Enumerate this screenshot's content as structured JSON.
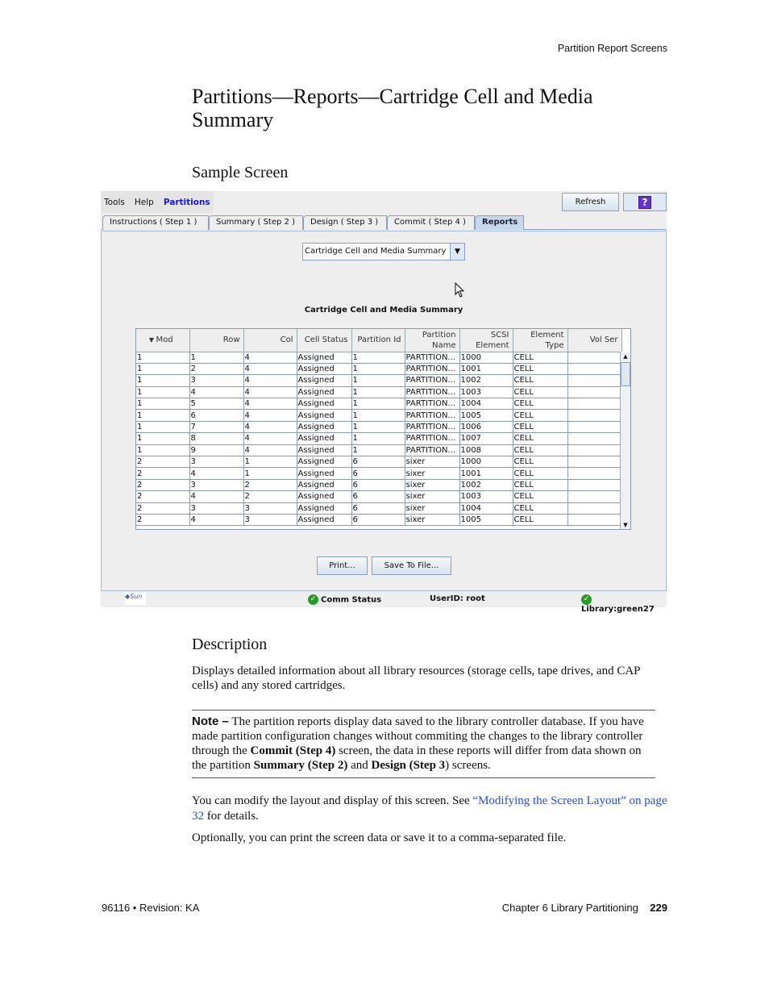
{
  "running_head": "Partition Report Screens",
  "title": "Partitions—Reports—Cartridge Cell and Media Summary",
  "sample_heading": "Sample Screen",
  "app": {
    "menu": [
      "Tools",
      "Help",
      "Partitions"
    ],
    "refresh_label": "Refresh",
    "help_label": "?",
    "tabs": [
      "Instructions ( Step 1 )",
      "Summary ( Step 2 )",
      "Design ( Step 3 )",
      "Commit ( Step 4 )",
      "Reports"
    ],
    "active_tab": "Reports",
    "report_select": "Cartridge Cell and Media Summary",
    "table_title": "Cartridge Cell and Media Summary",
    "columns": [
      "Mod",
      "Row",
      "Col",
      "Cell Status",
      "Partition Id",
      "Partition Name",
      "SCSI Element",
      "Element Type",
      "Vol Ser"
    ],
    "sort_column": "Mod",
    "rows": [
      [
        "1",
        "1",
        "4",
        "Assigned",
        "1",
        "PARTITION...",
        "1000",
        "CELL",
        ""
      ],
      [
        "1",
        "2",
        "4",
        "Assigned",
        "1",
        "PARTITION...",
        "1001",
        "CELL",
        ""
      ],
      [
        "1",
        "3",
        "4",
        "Assigned",
        "1",
        "PARTITION...",
        "1002",
        "CELL",
        ""
      ],
      [
        "1",
        "4",
        "4",
        "Assigned",
        "1",
        "PARTITION...",
        "1003",
        "CELL",
        ""
      ],
      [
        "1",
        "5",
        "4",
        "Assigned",
        "1",
        "PARTITION...",
        "1004",
        "CELL",
        ""
      ],
      [
        "1",
        "6",
        "4",
        "Assigned",
        "1",
        "PARTITION...",
        "1005",
        "CELL",
        ""
      ],
      [
        "1",
        "7",
        "4",
        "Assigned",
        "1",
        "PARTITION...",
        "1006",
        "CELL",
        ""
      ],
      [
        "1",
        "8",
        "4",
        "Assigned",
        "1",
        "PARTITION...",
        "1007",
        "CELL",
        ""
      ],
      [
        "1",
        "9",
        "4",
        "Assigned",
        "1",
        "PARTITION...",
        "1008",
        "CELL",
        ""
      ],
      [
        "2",
        "3",
        "1",
        "Assigned",
        "6",
        "sixer",
        "1000",
        "CELL",
        ""
      ],
      [
        "2",
        "4",
        "1",
        "Assigned",
        "6",
        "sixer",
        "1001",
        "CELL",
        ""
      ],
      [
        "2",
        "3",
        "2",
        "Assigned",
        "6",
        "sixer",
        "1002",
        "CELL",
        ""
      ],
      [
        "2",
        "4",
        "2",
        "Assigned",
        "6",
        "sixer",
        "1003",
        "CELL",
        ""
      ],
      [
        "2",
        "3",
        "3",
        "Assigned",
        "6",
        "sixer",
        "1004",
        "CELL",
        ""
      ],
      [
        "2",
        "4",
        "3",
        "Assigned",
        "6",
        "sixer",
        "1005",
        "CELL",
        ""
      ]
    ],
    "print_label": "Print...",
    "save_label": "Save To File...",
    "status": {
      "comm": "Comm Status",
      "user": "UserID: root",
      "library": "Library:green27"
    }
  },
  "description_heading": "Description",
  "description": "Displays detailed information about all library resources (storage cells, tape drives, and CAP cells) and any stored cartridges.",
  "note": {
    "label": "Note –",
    "t1": " The partition reports display data saved to the library controller database. If you have made partition configuration changes without commiting the changes to the library controller through the ",
    "b1": "Commit (Step 4)",
    "t2": " screen, the data in these reports will differ from data shown on the partition ",
    "b2": "Summary (Step 2)",
    "t3": " and ",
    "b3": "Design (Step 3",
    "t4": ") screens."
  },
  "para2": {
    "t1": "You can modify the layout and display of this screen. See ",
    "link": "“Modifying the Screen Layout” on page 32",
    "t2": " for details."
  },
  "para3": "Optionally, you can print the screen data or save it to a comma-separated file.",
  "footer": {
    "left": "96116 • Revision: KA",
    "chapter": "Chapter 6 Library Partitioning",
    "page": "229"
  }
}
